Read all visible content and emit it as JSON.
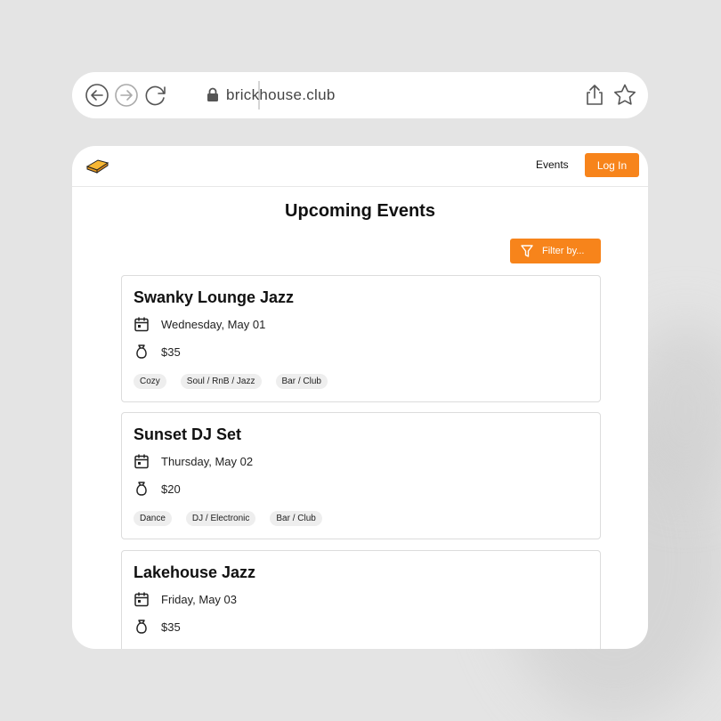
{
  "browser": {
    "url": "brickhouse.club",
    "icons": [
      "back-icon",
      "forward-icon",
      "reload-icon",
      "lock-icon",
      "share-icon",
      "star-icon"
    ]
  },
  "nav": {
    "events_label": "Events",
    "login_label": "Log In",
    "logo_icon": "brick-logo-icon"
  },
  "page": {
    "title": "Upcoming Events",
    "filter_label": "Filter by..."
  },
  "colors": {
    "accent": "#f7841b",
    "background": "#e4e4e4",
    "tag_bg": "#eeeeee"
  },
  "events": [
    {
      "title": "Swanky Lounge Jazz",
      "date": "Wednesday, May 01",
      "price": "$35",
      "tags": [
        "Cozy",
        "Soul / RnB / Jazz",
        "Bar / Club"
      ]
    },
    {
      "title": "Sunset DJ Set",
      "date": "Thursday, May 02",
      "price": "$20",
      "tags": [
        "Dance",
        "DJ / Electronic",
        "Bar / Club"
      ]
    },
    {
      "title": "Lakehouse Jazz",
      "date": "Friday, May 03",
      "price": "$35",
      "tags": []
    }
  ]
}
